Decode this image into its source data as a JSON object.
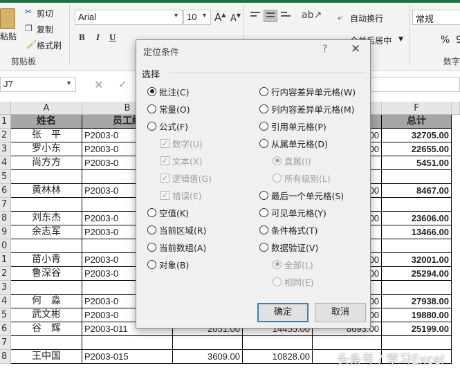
{
  "ribbon": {
    "paste_label": "粘贴",
    "cut_label": "剪切",
    "copy_label": "复制",
    "format_painter_label": "格式刷",
    "clipboard_group": "剪贴板",
    "font_name": "Arial",
    "font_size": "10",
    "bold": "B",
    "italic": "I",
    "underline": "U",
    "wrap_text_label": "自动换行",
    "merge_center_label": "合并后居中",
    "number_format": "常规",
    "percent": "%",
    "comma": "9",
    "number_group": "数字",
    "accent_color": "#217346"
  },
  "formula_bar": {
    "name_box": "J7",
    "cancel_icon": "✕",
    "enter_icon": "✓"
  },
  "grid": {
    "columns": [
      "A",
      "B",
      "F"
    ],
    "row_numbers": [
      "1",
      "2",
      "3",
      "4",
      "5",
      "6",
      "7",
      "8",
      "9",
      "0",
      "1",
      "2",
      "3",
      "4",
      "5",
      "6",
      "7",
      "8"
    ],
    "header": {
      "a": "姓名",
      "b": "员工编",
      "f": "总计"
    },
    "rows": [
      {
        "a": "张　平",
        "b": "P2003-0",
        "e": ".00",
        "f": "32705.00"
      },
      {
        "a": "罗小东",
        "b": "P2003-0",
        "e": ".00",
        "f": "22655.00"
      },
      {
        "a": "尚方方",
        "b": "P2003-0",
        "e": "",
        "f": "5451.00"
      },
      {
        "a": "",
        "b": "",
        "e": "",
        "f": ""
      },
      {
        "a": "黄林林",
        "b": "P2003-0",
        "e": ".00",
        "f": "8467.00"
      },
      {
        "a": "",
        "b": "",
        "e": "",
        "f": ""
      },
      {
        "a": "刘东杰",
        "b": "P2003-0",
        "e": ".00",
        "f": "23606.00"
      },
      {
        "a": "余志军",
        "b": "P2003-0",
        "e": "",
        "f": "13466.00"
      },
      {
        "a": "",
        "b": "",
        "e": "",
        "f": ""
      },
      {
        "a": "苗小青",
        "b": "P2003-0",
        "e": ".00",
        "f": "32001.00"
      },
      {
        "a": "鲁深谷",
        "b": "P2003-0",
        "e": ".00",
        "f": "25294.00"
      },
      {
        "a": "",
        "b": "",
        "e": "",
        "f": ""
      },
      {
        "a": "何　淼",
        "b": "P2003-0",
        "e": ".00",
        "f": "27938.00"
      },
      {
        "a": "武文彬",
        "b": "P2003-0",
        "e": ".00",
        "f": "19880.00"
      },
      {
        "a": "谷　辉",
        "b": "P2003-011",
        "c": "2051.00",
        "d": "14455.00",
        "e": "8693.00",
        "f": "25199.00"
      },
      {
        "a": "",
        "b": "",
        "e": "",
        "f": ""
      },
      {
        "a": "王中国",
        "b": "P2003-015",
        "c": "3609.00",
        "d": "10828.00",
        "e": "",
        "f": ""
      }
    ]
  },
  "dialog": {
    "title": "定位条件",
    "help": "?",
    "close": "✕",
    "group_caption": "选择",
    "left_options": [
      {
        "label": "批注(C)",
        "selected": true
      },
      {
        "label": "常量(O)",
        "selected": false
      },
      {
        "label": "公式(F)",
        "selected": false
      }
    ],
    "formula_subs": [
      {
        "label": "数字(U)"
      },
      {
        "label": "文本(X)"
      },
      {
        "label": "逻辑值(G)"
      },
      {
        "label": "错误(E)"
      }
    ],
    "left_options_2": [
      {
        "label": "空值(K)"
      },
      {
        "label": "当前区域(R)"
      },
      {
        "label": "当前数组(A)"
      },
      {
        "label": "对象(B)"
      }
    ],
    "right_options": [
      {
        "label": "行内容差异单元格(W)"
      },
      {
        "label": "列内容差异单元格(M)"
      },
      {
        "label": "引用单元格(P)"
      },
      {
        "label": "从属单元格(D)"
      }
    ],
    "dependents_subs": [
      {
        "label": "直属(I)",
        "selected": true
      },
      {
        "label": "所有级别(L)",
        "selected": false
      }
    ],
    "right_options_2": [
      {
        "label": "最后一个单元格(S)"
      },
      {
        "label": "可见单元格(Y)"
      },
      {
        "label": "条件格式(T)"
      },
      {
        "label": "数据验证(V)"
      }
    ],
    "validation_subs": [
      {
        "label": "全部(L)",
        "selected": true
      },
      {
        "label": "相同(E)",
        "selected": false
      }
    ],
    "ok_label": "确定",
    "cancel_label": "取消"
  },
  "watermark": "头条号 / 学习Excel"
}
